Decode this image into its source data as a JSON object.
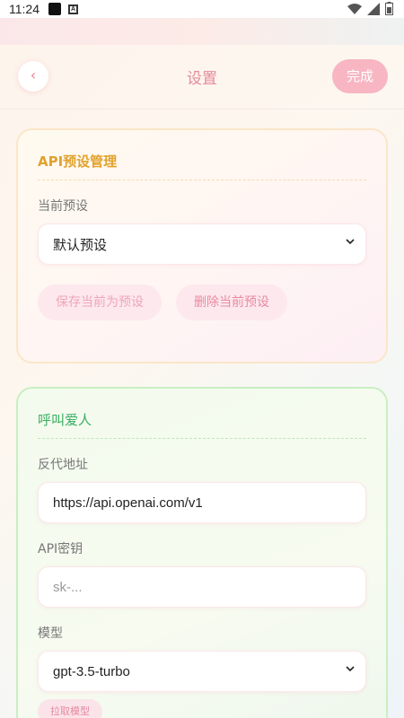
{
  "status_bar": {
    "time": "11:24"
  },
  "header": {
    "back_label": "‹",
    "title": "设置",
    "done_label": "完成"
  },
  "api_presets": {
    "title": "API预设管理",
    "current_preset_label": "当前预设",
    "current_preset_value": "默认预设",
    "save_button": "保存当前为预设",
    "delete_button": "删除当前预设"
  },
  "call_lover": {
    "title": "呼叫爱人",
    "proxy_label": "反代地址",
    "proxy_value": "https://api.openai.com/v1",
    "api_key_label": "API密钥",
    "api_key_placeholder": "sk-...",
    "model_label": "模型",
    "model_value": "gpt-3.5-turbo",
    "fetch_models_button": "拉取模型"
  },
  "colors": {
    "accent": "#e68a9b",
    "done_button": "#f7b6c2",
    "api_title": "#e1a22c",
    "call_title": "#3aae62"
  },
  "icons": [
    "back-icon",
    "chevron-down-icon",
    "wifi-icon",
    "signal-icon",
    "battery-icon"
  ]
}
